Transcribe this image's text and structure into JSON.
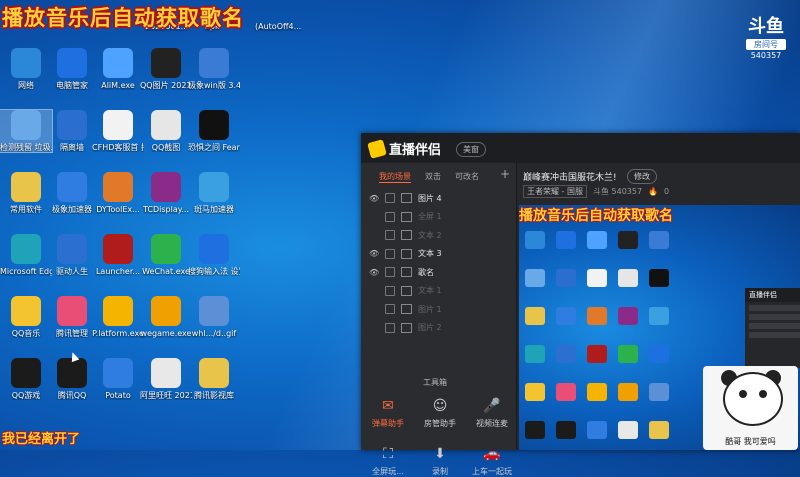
{
  "overlay": {
    "title": "播放音乐后自动获取歌名",
    "bottom_text": "我已经离开了"
  },
  "top_strip": {
    "labels": [
      "2021061...",
      "apk",
      "(AutoOff4..."
    ]
  },
  "desktop_icons": [
    {
      "label": "网络",
      "icon": "network-icon",
      "color": "#2b88d8"
    },
    {
      "label": "电脑管家",
      "icon": "shield-icon",
      "color": "#1e6fe0"
    },
    {
      "label": "AliM.exe",
      "icon": "ali-icon",
      "color": "#4da3ff"
    },
    {
      "label": "QQ图片 2021080b...",
      "icon": "image-icon",
      "color": "#222222"
    },
    {
      "label": "极象win版 3.4.0.exe",
      "icon": "app-icon",
      "color": "#3a7bd5"
    },
    {
      "label": "检测残留 垃圾...",
      "icon": "recycle-bin-icon",
      "color": "#6aa9e8"
    },
    {
      "label": "隔离墙",
      "icon": "qq-icon",
      "color": "#2a6fcf"
    },
    {
      "label": "CFHD客服首 拉大...",
      "icon": "document-icon",
      "color": "#f2f2f2"
    },
    {
      "label": "QQ截图",
      "icon": "image-icon",
      "color": "#e6e6e6"
    },
    {
      "label": "恐惧之间 Fear sun...",
      "icon": "game-icon",
      "color": "#111111"
    },
    {
      "label": "常用软件",
      "icon": "folder-icon",
      "color": "#e8c44a"
    },
    {
      "label": "极象加速器",
      "icon": "rocket-icon",
      "color": "#2f7de1"
    },
    {
      "label": "DYToolEx...",
      "icon": "tool-icon",
      "color": "#e07a2a"
    },
    {
      "label": "TCDisplay...",
      "icon": "archive-icon",
      "color": "#8a2b8a"
    },
    {
      "label": "斑马加速器",
      "icon": "speed-icon",
      "color": "#3aa0e0"
    },
    {
      "label": "Microsoft Edge",
      "icon": "edge-icon",
      "color": "#1fa3b8"
    },
    {
      "label": "驱动人生",
      "icon": "gear-icon",
      "color": "#2b6fd0"
    },
    {
      "label": "Launcher...",
      "icon": "launcher-icon",
      "color": "#b01c1c"
    },
    {
      "label": "WeChat.exe",
      "icon": "wechat-icon",
      "color": "#2bb24c"
    },
    {
      "label": "搜狗输入法 设置",
      "icon": "sogou-icon",
      "color": "#1e6fe0"
    },
    {
      "label": "QQ音乐",
      "icon": "music-icon",
      "color": "#f4c430"
    },
    {
      "label": "腾讯管理",
      "icon": "grid-icon",
      "color": "#e94e77"
    },
    {
      "label": "P.latform.exe",
      "icon": "wegame-icon",
      "color": "#f5b400"
    },
    {
      "label": "wegame.exe",
      "icon": "wegame-icon",
      "color": "#f0a000"
    },
    {
      "label": "whl.../d..gif",
      "icon": "image-icon",
      "color": "#5b8fd6"
    },
    {
      "label": "QQ游戏",
      "icon": "penguin-icon",
      "color": "#1b1b1b"
    },
    {
      "label": "腾讯QQ",
      "icon": "penguin-icon",
      "color": "#1b1b1b"
    },
    {
      "label": "Potato",
      "icon": "potato-icon",
      "color": "#2f7de1"
    },
    {
      "label": "阿里旺旺 2021081...",
      "icon": "image-icon",
      "color": "#e8e8e8"
    },
    {
      "label": "腾讯影视库",
      "icon": "folder-icon",
      "color": "#e8c44a"
    }
  ],
  "douyu": {
    "glyph": "斗鱼",
    "badge": "房间号",
    "room": "540357"
  },
  "app": {
    "logo": "直播伴侣",
    "pill": "美窗",
    "tabs": [
      "我的场景",
      "双击",
      "可改名"
    ],
    "sources": [
      {
        "label": "图片 4",
        "visible": true
      },
      {
        "label": "全屏 1",
        "visible": false
      },
      {
        "label": "文本 2",
        "visible": false
      },
      {
        "label": "文本 3",
        "visible": true
      },
      {
        "label": "歌名",
        "visible": true
      },
      {
        "label": "文本 1",
        "visible": false
      },
      {
        "label": "图片 1",
        "visible": false
      },
      {
        "label": "图片 2",
        "visible": false
      }
    ],
    "toolbox_title": "工具箱",
    "tools": [
      {
        "label": "弹幕助手",
        "icon": "danmaku-icon"
      },
      {
        "label": "房管助手",
        "icon": "manager-icon"
      },
      {
        "label": "视频连麦",
        "icon": "mic-icon"
      },
      {
        "label": "全屏玩...",
        "icon": "fullscreen-icon"
      },
      {
        "label": "录制",
        "icon": "download-icon"
      },
      {
        "label": "上车一起玩",
        "icon": "car-icon"
      }
    ],
    "room_title": "巅峰赛冲击国服花木兰!",
    "edit_label": "修改",
    "category": "王者荣耀 - 国服",
    "room_meta": "斗鱼 540357",
    "hot": "0"
  },
  "meme": {
    "caption": "酷哥  我可爱吗"
  }
}
